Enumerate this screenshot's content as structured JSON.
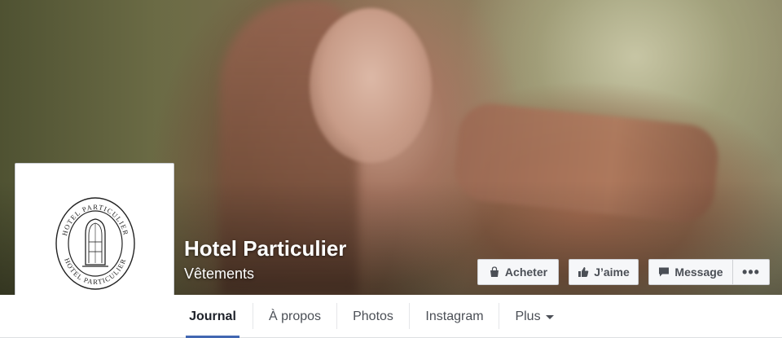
{
  "page": {
    "name": "Hotel Particulier",
    "category": "Vêtements"
  },
  "logo": {
    "top_text": "HOTEL PARTICULIER",
    "bottom_text": "HOTEL PARTICULIER"
  },
  "actions": {
    "buy_label": "Acheter",
    "like_label": "J’aime",
    "message_label": "Message",
    "more_label": "•••"
  },
  "tabs": [
    {
      "label": "Journal",
      "active": true
    },
    {
      "label": "À propos",
      "active": false
    },
    {
      "label": "Photos",
      "active": false
    },
    {
      "label": "Instagram",
      "active": false
    },
    {
      "label": "Plus",
      "active": false
    }
  ],
  "icons": {
    "buy": "shopping-bag-icon",
    "like": "thumbs-up-icon",
    "message": "message-bubble-icon",
    "plus": "caret-down-icon"
  },
  "colors": {
    "accent": "#4267b2",
    "button_bg": "#f6f7f9",
    "button_text": "#4b4f56"
  }
}
